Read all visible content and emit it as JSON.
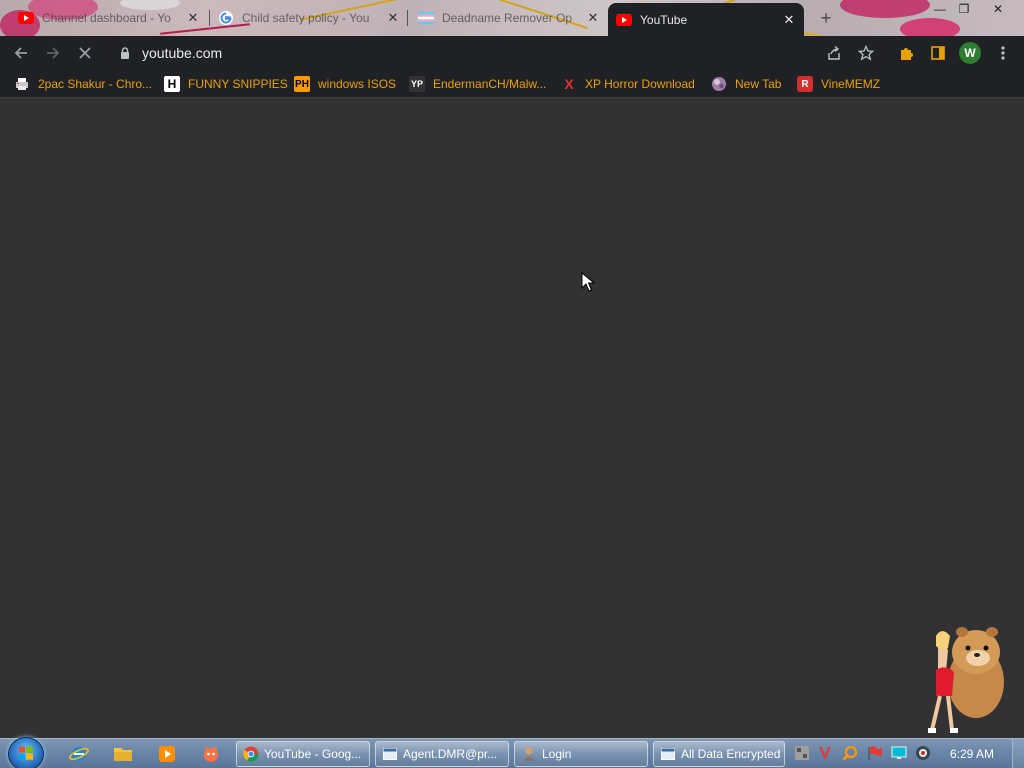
{
  "tabs": [
    {
      "label": "Channel dashboard - Yo",
      "icon": "youtube-icon",
      "close": "✕"
    },
    {
      "label": "Child safety policy - You",
      "icon": "google-icon",
      "close": "✕"
    },
    {
      "label": "Deadname Remover Op",
      "icon": "flag-icon",
      "close": "✕"
    },
    {
      "label": "YouTube",
      "icon": "youtube-icon",
      "close": "✕",
      "active": true
    }
  ],
  "new_tab": "+",
  "window_controls": {
    "minimize": "—",
    "maximize": "❐",
    "close": "✕"
  },
  "address_bar": {
    "url": "youtube.com"
  },
  "profile_initial": "W",
  "bookmarks": [
    {
      "label": "2pac Shakur - Chro...",
      "icon": "printer-icon"
    },
    {
      "label": "FUNNY SNIPPIES",
      "icon": "h-logo-icon"
    },
    {
      "label": "windows ISOS",
      "icon": "ph-logo-icon"
    },
    {
      "label": "EndermanCH/Malw...",
      "icon": "yp-logo-icon"
    },
    {
      "label": "XP Horror Download",
      "icon": "x-logo-icon"
    },
    {
      "label": "New Tab",
      "icon": "globe-icon"
    },
    {
      "label": "VineMEMZ",
      "icon": "r-logo-icon"
    }
  ],
  "taskbar": {
    "tasks": [
      {
        "label": "YouTube - Goog...",
        "icon": "chrome-icon"
      },
      {
        "label": "Agent.DMR@pr...",
        "icon": "window-icon"
      },
      {
        "label": "Login",
        "icon": "person-icon"
      },
      {
        "label": "All Data Encrypted",
        "icon": "window-icon"
      }
    ],
    "clock": "6:29 AM"
  },
  "colors": {
    "page_bg": "#323232",
    "chrome_bg": "#202124",
    "bookmark_text": "#e8a200",
    "profile_green": "#2e7d32"
  }
}
